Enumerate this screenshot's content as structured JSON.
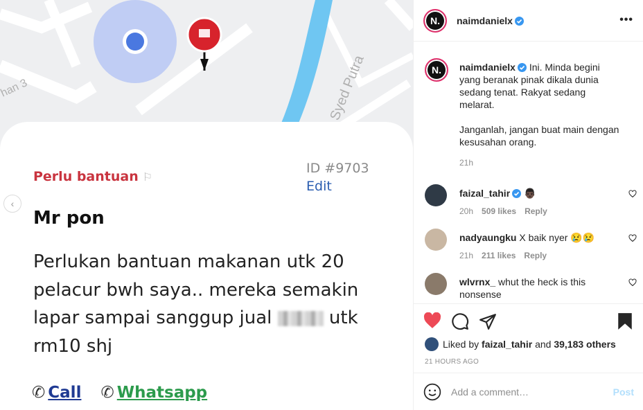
{
  "post": {
    "image": {
      "map": {
        "road_label_1": "han 3",
        "road_label_2": "Syed Putra"
      },
      "card": {
        "status": "Perlu bantuan",
        "status_flag": "⚐",
        "id_text": "ID #9703",
        "edit_label": "Edit",
        "name": "Mr pon",
        "body_before": "Perlukan bantuan makanan utk 20 pelacur bwh saya.. mereka semakin lapar sampai sanggup jual",
        "body_after": "utk rm10 shj",
        "call_label": "Call",
        "whatsapp_label": "Whatsapp"
      }
    }
  },
  "header": {
    "username": "naimdanielx",
    "avatar_text": "N."
  },
  "caption": {
    "username": "naimdanielx",
    "text_1": "Ini. Minda begini yang beranak pinak dikala dunia sedang tenat. Rakyat sedang melarat.",
    "text_2": "Janganlah, jangan buat main dengan kesusahan orang.",
    "time": "21h"
  },
  "comments": [
    {
      "username": "faizal_tahir",
      "verified": true,
      "text": "",
      "emoji": "👨🏿",
      "time": "20h",
      "likes": "509 likes",
      "reply": "Reply",
      "avatar_color": "#2f3a46"
    },
    {
      "username": "nadyaungku",
      "verified": false,
      "text": "X baik nyer",
      "emoji": "😢😢",
      "time": "21h",
      "likes": "211 likes",
      "reply": "Reply",
      "avatar_color": "#c9b7a3"
    },
    {
      "username": "wlvrnx_",
      "verified": false,
      "text": "whut the heck is this nonsense",
      "emoji": "",
      "time": "",
      "likes": "",
      "reply": "",
      "avatar_color": "#8a7a6a"
    }
  ],
  "actions": {
    "liked_prefix": "Liked by",
    "liked_user": "faizal_tahir",
    "liked_and": "and",
    "liked_count": "39,183 others",
    "age": "21 HOURS AGO"
  },
  "add_comment": {
    "placeholder": "Add a comment…",
    "post_label": "Post"
  },
  "colors": {
    "heart": "#ed4956",
    "verified": "#3897f0",
    "link": "#2a5db0",
    "status_red": "#c9343f",
    "whatsapp": "#2c9b4c"
  }
}
